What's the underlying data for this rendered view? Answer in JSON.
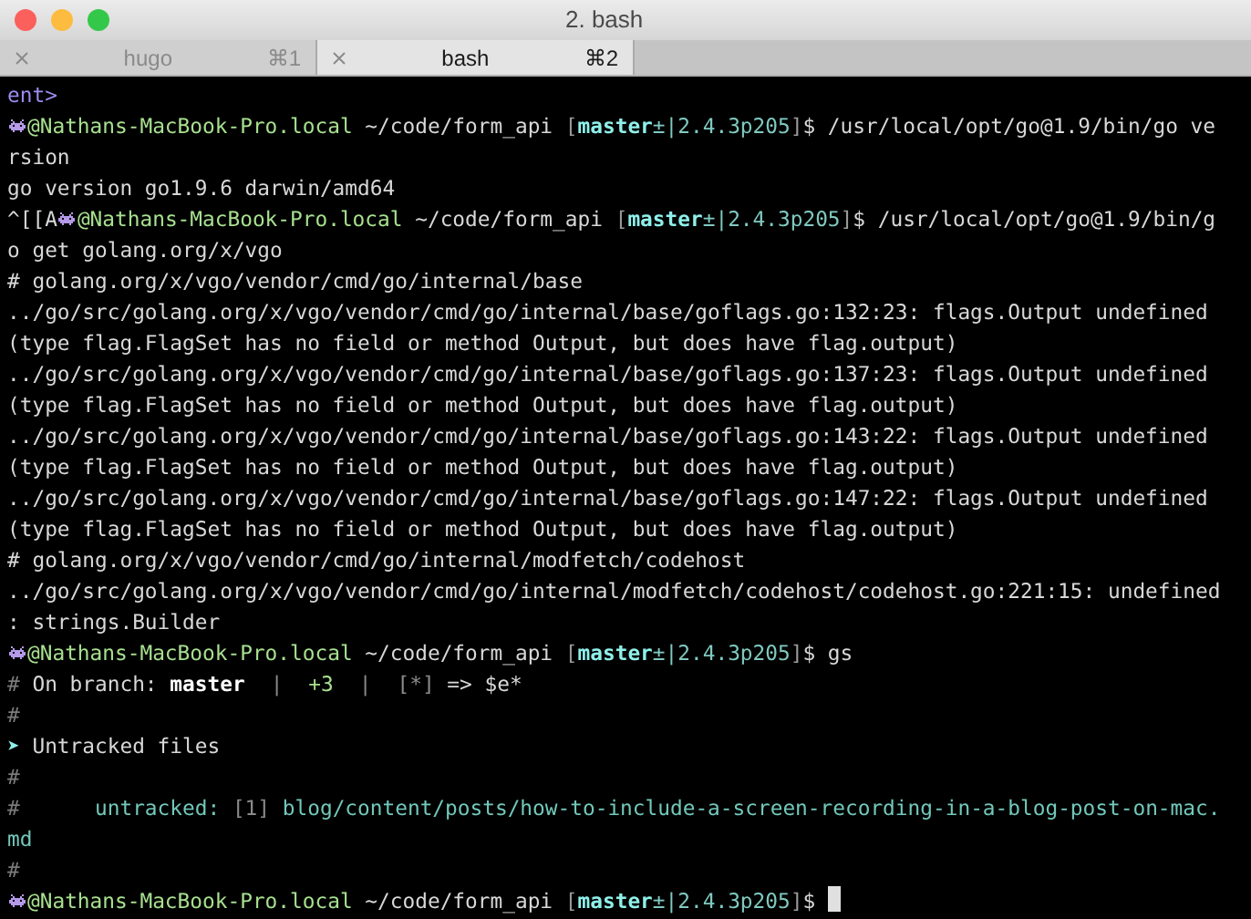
{
  "window": {
    "title": "2. bash"
  },
  "tabs": [
    {
      "label": "hugo",
      "shortcut": "⌘1",
      "selected": false
    },
    {
      "label": "bash",
      "shortcut": "⌘2",
      "selected": true
    }
  ],
  "terminal": {
    "lines": [
      [
        {
          "kind": "purple",
          "text": "ent>"
        }
      ],
      [
        {
          "kind": "icon"
        },
        {
          "kind": "host",
          "text": "@Nathans-MacBook-Pro.local"
        },
        {
          "kind": "path",
          "text": " ~/code/form_api "
        },
        {
          "kind": "bracket",
          "text": "["
        },
        {
          "kind": "branch",
          "text": "master"
        },
        {
          "kind": "version",
          "text": "±|2.4.3p205"
        },
        {
          "kind": "bracket",
          "text": "]"
        },
        {
          "kind": "plain",
          "text": "$ /usr/local/opt/go@1.9/bin/go ve"
        }
      ],
      [
        {
          "kind": "plain",
          "text": "rsion"
        }
      ],
      [
        {
          "kind": "plain",
          "text": "go version go1.9.6 darwin/amd64"
        }
      ],
      [
        {
          "kind": "plain",
          "text": "^[[A"
        },
        {
          "kind": "icon"
        },
        {
          "kind": "host",
          "text": "@Nathans-MacBook-Pro.local"
        },
        {
          "kind": "path",
          "text": " ~/code/form_api "
        },
        {
          "kind": "bracket",
          "text": "["
        },
        {
          "kind": "branch",
          "text": "master"
        },
        {
          "kind": "version",
          "text": "±|2.4.3p205"
        },
        {
          "kind": "bracket",
          "text": "]"
        },
        {
          "kind": "plain",
          "text": "$ /usr/local/opt/go@1.9/bin/g"
        }
      ],
      [
        {
          "kind": "plain",
          "text": "o get golang.org/x/vgo"
        }
      ],
      [
        {
          "kind": "plain",
          "text": "# golang.org/x/vgo/vendor/cmd/go/internal/base"
        }
      ],
      [
        {
          "kind": "plain",
          "text": "../go/src/golang.org/x/vgo/vendor/cmd/go/internal/base/goflags.go:132:23: flags.Output undefined"
        }
      ],
      [
        {
          "kind": "plain",
          "text": "(type flag.FlagSet has no field or method Output, but does have flag.output)"
        }
      ],
      [
        {
          "kind": "plain",
          "text": "../go/src/golang.org/x/vgo/vendor/cmd/go/internal/base/goflags.go:137:23: flags.Output undefined"
        }
      ],
      [
        {
          "kind": "plain",
          "text": "(type flag.FlagSet has no field or method Output, but does have flag.output)"
        }
      ],
      [
        {
          "kind": "plain",
          "text": "../go/src/golang.org/x/vgo/vendor/cmd/go/internal/base/goflags.go:143:22: flags.Output undefined"
        }
      ],
      [
        {
          "kind": "plain",
          "text": "(type flag.FlagSet has no field or method Output, but does have flag.output)"
        }
      ],
      [
        {
          "kind": "plain",
          "text": "../go/src/golang.org/x/vgo/vendor/cmd/go/internal/base/goflags.go:147:22: flags.Output undefined"
        }
      ],
      [
        {
          "kind": "plain",
          "text": "(type flag.FlagSet has no field or method Output, but does have flag.output)"
        }
      ],
      [
        {
          "kind": "plain",
          "text": "# golang.org/x/vgo/vendor/cmd/go/internal/modfetch/codehost"
        }
      ],
      [
        {
          "kind": "plain",
          "text": "../go/src/golang.org/x/vgo/vendor/cmd/go/internal/modfetch/codehost/codehost.go:221:15: undefined"
        }
      ],
      [
        {
          "kind": "plain",
          "text": ": strings.Builder"
        }
      ],
      [
        {
          "kind": "icon"
        },
        {
          "kind": "host",
          "text": "@Nathans-MacBook-Pro.local"
        },
        {
          "kind": "path",
          "text": " ~/code/form_api "
        },
        {
          "kind": "bracket",
          "text": "["
        },
        {
          "kind": "branch",
          "text": "master"
        },
        {
          "kind": "version",
          "text": "±|2.4.3p205"
        },
        {
          "kind": "bracket",
          "text": "]"
        },
        {
          "kind": "plain",
          "text": "$ gs"
        }
      ],
      [
        {
          "kind": "comment",
          "text": "#"
        },
        {
          "kind": "plain",
          "text": " On branch: "
        },
        {
          "kind": "bold",
          "text": "master"
        },
        {
          "kind": "gap"
        },
        {
          "kind": "dim",
          "text": "|"
        },
        {
          "kind": "gap"
        },
        {
          "kind": "green",
          "text": "+3"
        },
        {
          "kind": "gap"
        },
        {
          "kind": "dim",
          "text": "|"
        },
        {
          "kind": "gap"
        },
        {
          "kind": "dim",
          "text": "[*]"
        },
        {
          "kind": "plain",
          "text": " => $e*"
        }
      ],
      [
        {
          "kind": "comment",
          "text": "#"
        }
      ],
      [
        {
          "kind": "arrow",
          "text": "➤"
        },
        {
          "kind": "plain",
          "text": " Untracked files"
        }
      ],
      [
        {
          "kind": "comment",
          "text": "#"
        }
      ],
      [
        {
          "kind": "comment",
          "text": "#"
        },
        {
          "kind": "teal",
          "text": "      untracked: "
        },
        {
          "kind": "dim",
          "text": "[1]"
        },
        {
          "kind": "teal",
          "text": " blog/content/posts/how-to-include-a-screen-recording-in-a-blog-post-on-mac."
        }
      ],
      [
        {
          "kind": "teal",
          "text": "md"
        }
      ],
      [
        {
          "kind": "comment",
          "text": "#"
        }
      ],
      [
        {
          "kind": "icon"
        },
        {
          "kind": "host",
          "text": "@Nathans-MacBook-Pro.local"
        },
        {
          "kind": "path",
          "text": " ~/code/form_api "
        },
        {
          "kind": "bracket",
          "text": "["
        },
        {
          "kind": "branch",
          "text": "master"
        },
        {
          "kind": "version",
          "text": "±|2.4.3p205"
        },
        {
          "kind": "bracket",
          "text": "]"
        },
        {
          "kind": "plain",
          "text": "$ "
        },
        {
          "kind": "cursor"
        }
      ]
    ]
  }
}
